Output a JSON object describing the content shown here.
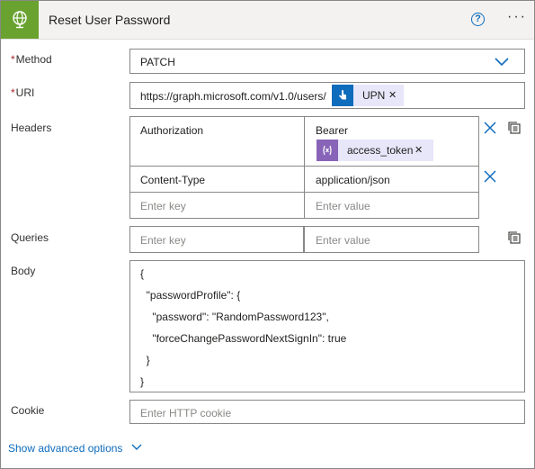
{
  "card": {
    "title": "Reset User Password",
    "icon": "globe-icon",
    "help_glyph": "?",
    "more_glyph": "···"
  },
  "method": {
    "label": "Method",
    "required_mark": "*",
    "value": "PATCH"
  },
  "uri": {
    "label": "URI",
    "required_mark": "*",
    "value": "https://graph.microsoft.com/v1.0/users/",
    "token": {
      "label": "UPN",
      "icon": "manual-trigger-icon",
      "color": "#0f6cbd"
    }
  },
  "headers": {
    "label": "Headers",
    "rows": [
      {
        "key": "Authorization",
        "value": "Bearer",
        "token": {
          "label": "access_token",
          "icon": "variable-icon",
          "color": "#770bd6"
        }
      },
      {
        "key": "Content-Type",
        "value": "application/json"
      }
    ],
    "key_placeholder": "Enter key",
    "value_placeholder": "Enter value"
  },
  "queries": {
    "label": "Queries",
    "key_placeholder": "Enter key",
    "value_placeholder": "Enter value"
  },
  "body": {
    "label": "Body",
    "lines": [
      "{",
      "  \"passwordProfile\": {",
      "    \"password\": \"RandomPassword123\",",
      "    \"forceChangePasswordNextSignIn\": true",
      "  }",
      "}"
    ]
  },
  "cookie": {
    "label": "Cookie",
    "placeholder": "Enter HTTP cookie"
  },
  "advanced": {
    "label": "Show advanced options"
  },
  "colors": {
    "accent": "#0f6cbd",
    "header_icon_bg": "#69a22f",
    "required": "#a4262c"
  }
}
